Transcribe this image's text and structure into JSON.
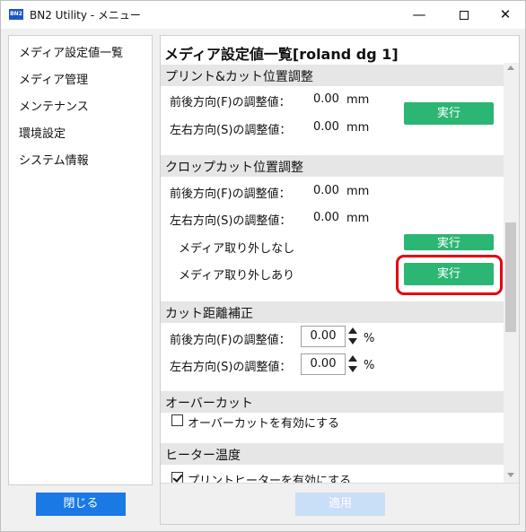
{
  "window": {
    "logo_text": "BN2",
    "title": "BN2 Utility - メニュー",
    "minimize": "—",
    "close": "✕"
  },
  "sidebar": {
    "items": [
      {
        "label": "メディア設定値一覧"
      },
      {
        "label": "メディア管理"
      },
      {
        "label": "メンテナンス"
      },
      {
        "label": "環境設定"
      },
      {
        "label": "システム情報"
      }
    ]
  },
  "main": {
    "title": "メディア設定値一覧[roland dg 1]",
    "print_cut": {
      "header": "プリント&カット位置調整",
      "rows": [
        {
          "label": "前後方向(F)の調整値：",
          "value": "0.00",
          "unit": "mm"
        },
        {
          "label": "左右方向(S)の調整値：",
          "value": "0.00",
          "unit": "mm"
        }
      ],
      "execute_label": "実行"
    },
    "crop_cut": {
      "header": "クロップカット位置調整",
      "rows": [
        {
          "label": "前後方向(F)の調整値：",
          "value": "0.00",
          "unit": "mm"
        },
        {
          "label": "左右方向(S)の調整値：",
          "value": "0.00",
          "unit": "mm"
        }
      ],
      "without_removal_label": "メディア取り外しなし",
      "with_removal_label": "メディア取り外しあり",
      "execute_label": "実行"
    },
    "cut_distance": {
      "header": "カット距離補正",
      "rows": [
        {
          "label": "前後方向(F)の調整値：",
          "value": "0.00",
          "unit": "%"
        },
        {
          "label": "左右方向(S)の調整値：",
          "value": "0.00",
          "unit": "%"
        }
      ]
    },
    "overcut": {
      "header": "オーバーカット",
      "checkbox_label": "オーバーカットを有効にする",
      "checked": false
    },
    "heater": {
      "header": "ヒーター温度",
      "checkbox_label": "プリントヒーターを有効にする",
      "checked": true
    },
    "apply_label": "適用"
  },
  "footer": {
    "close_label": "閉じる"
  },
  "colors": {
    "accent_green": "#2bb673",
    "accent_blue": "#1b79e6",
    "highlight_red": "#e60012",
    "disabled_blue": "#c9def7"
  },
  "icons": {
    "app": "bn2-logo-icon",
    "spin_up": "triangle-up-icon",
    "spin_down": "triangle-down-icon"
  }
}
